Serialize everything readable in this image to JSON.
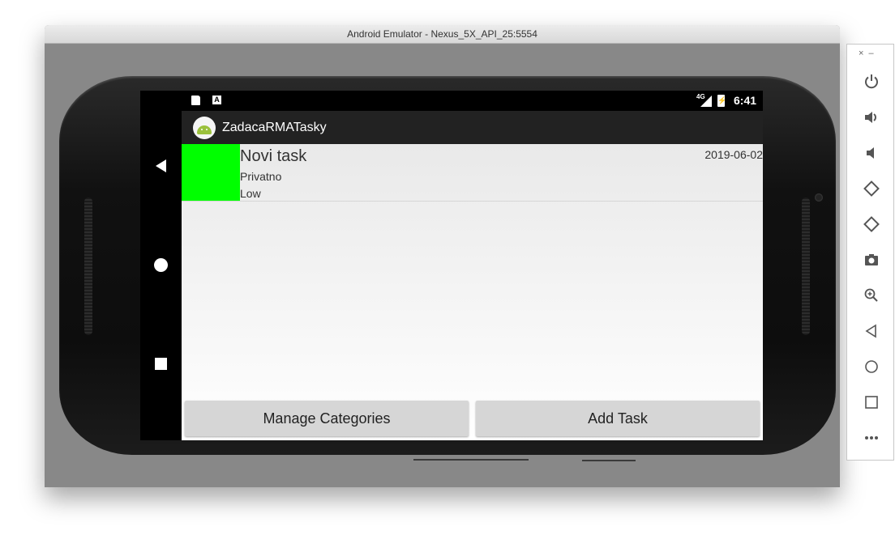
{
  "window": {
    "title": "Android Emulator - Nexus_5X_API_25:5554"
  },
  "statusbar": {
    "network": "4G",
    "time": "6:41",
    "a_indicator": "A"
  },
  "app": {
    "title": "ZadacaRMATasky"
  },
  "tasks": [
    {
      "name": "Novi task",
      "category": "Privatno",
      "priority": "Low",
      "date": "2019-06-02",
      "color": "#00ff00"
    }
  ],
  "buttons": {
    "manage_categories": "Manage Categories",
    "add_task": "Add Task"
  },
  "toolbar": {
    "close": "×",
    "minimize": "–",
    "items": [
      "power-icon",
      "volume-up-icon",
      "volume-down-icon",
      "rotate-left-icon",
      "rotate-right-icon",
      "camera-icon",
      "zoom-icon",
      "back-icon",
      "home-icon",
      "overview-icon",
      "more-icon"
    ]
  }
}
